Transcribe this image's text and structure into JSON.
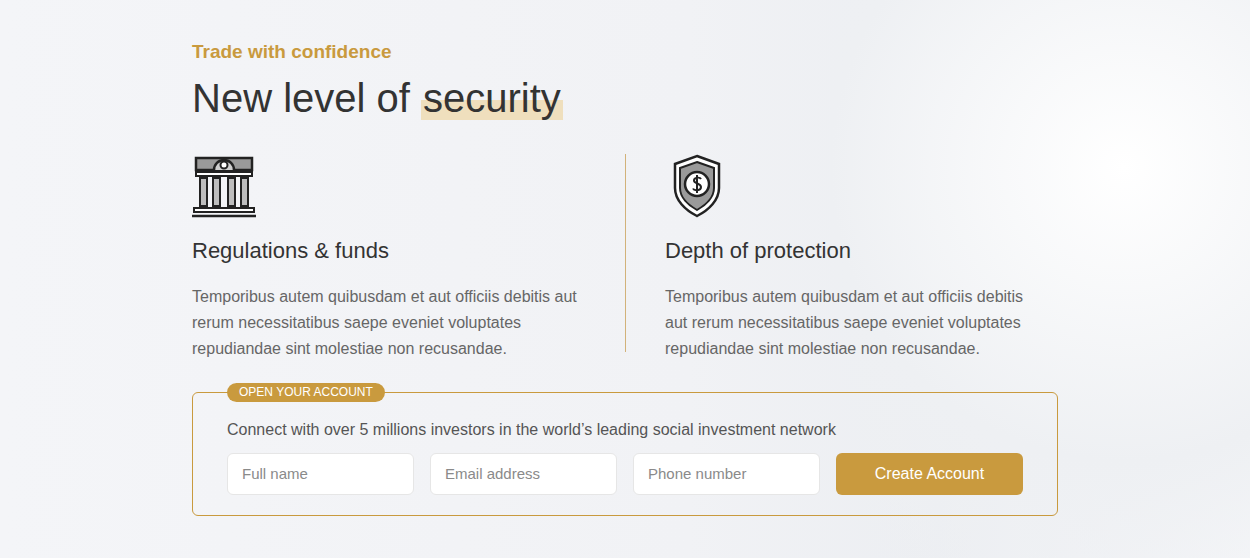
{
  "section": {
    "eyebrow": "Trade with confidence",
    "heading": "New level of",
    "highlight": "security"
  },
  "features": [
    {
      "title": "Regulations & funds",
      "text": "Temporibus autem quibusdam et aut officiis debitis aut rerum necessitatibus saepe eveniet voluptates repudiandae sint molestiae non recusandae."
    },
    {
      "title": "Depth of protection",
      "text": "Temporibus autem quibusdam et aut officiis debitis aut rerum necessitatibus saepe eveniet voluptates repudiandae sint molestiae non recusandae."
    }
  ],
  "signup": {
    "badge": "OPEN YOUR ACCOUNT",
    "text": "Connect with over 5 millions investors in the world’s leading social investment network",
    "fields": [
      {
        "placeholder": "Full name"
      },
      {
        "placeholder": "Email address"
      },
      {
        "placeholder": "Phone number"
      }
    ],
    "button": "Create Account"
  }
}
